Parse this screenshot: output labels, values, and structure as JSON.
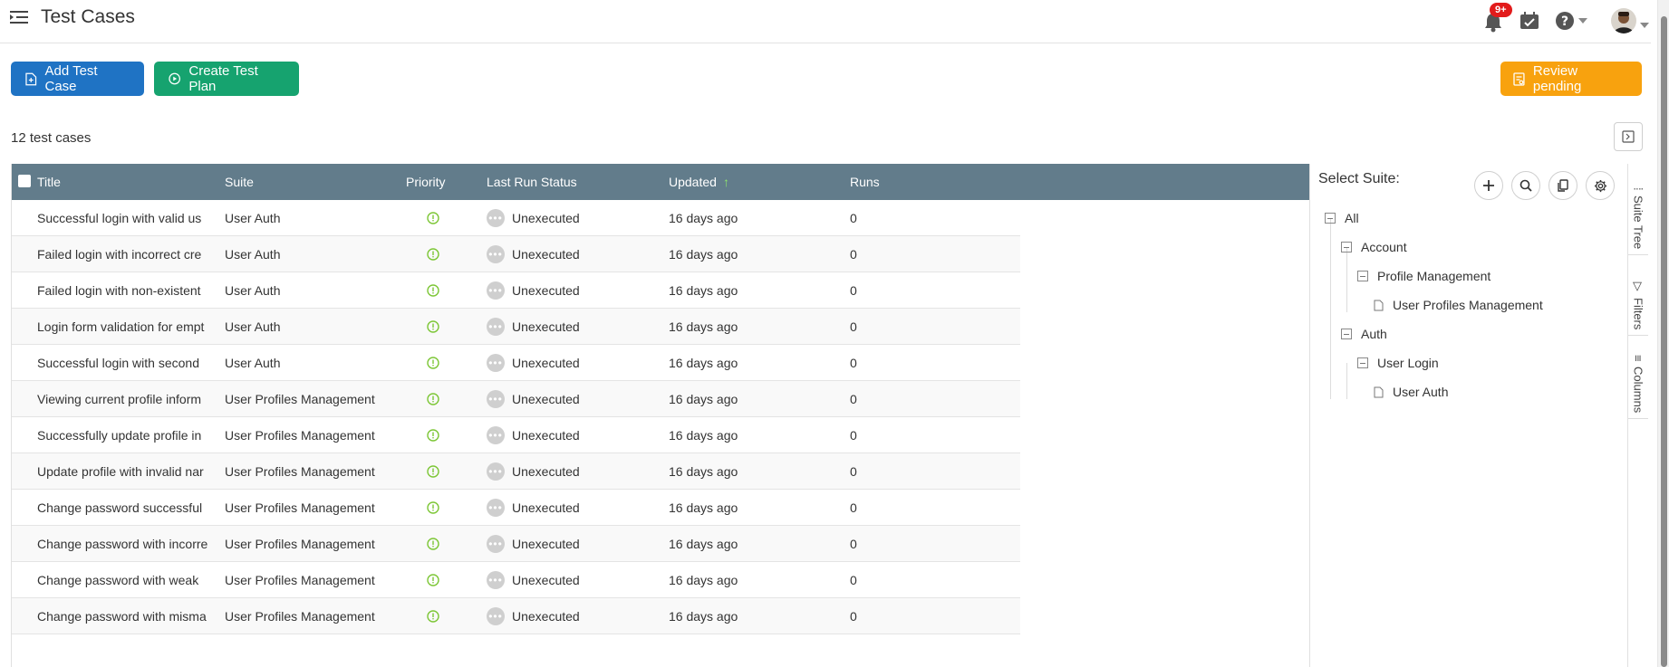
{
  "header": {
    "title": "Test Cases",
    "notification_badge": "9+"
  },
  "toolbar": {
    "add_label": "Add Test Case",
    "plan_label": "Create Test Plan",
    "review_label": "Review pending"
  },
  "summary": {
    "count_text": "12 test cases"
  },
  "table": {
    "columns": [
      "Title",
      "Suite",
      "Priority",
      "Last Run Status",
      "Updated",
      "Runs"
    ],
    "sort_indicator": "↑",
    "rows": [
      {
        "title": "Successful login with valid us",
        "suite": "User Auth",
        "status": "Unexecuted",
        "updated": "16 days ago",
        "runs": "0"
      },
      {
        "title": "Failed login with incorrect cre",
        "suite": "User Auth",
        "status": "Unexecuted",
        "updated": "16 days ago",
        "runs": "0"
      },
      {
        "title": "Failed login with non-existent",
        "suite": "User Auth",
        "status": "Unexecuted",
        "updated": "16 days ago",
        "runs": "0"
      },
      {
        "title": "Login form validation for empt",
        "suite": "User Auth",
        "status": "Unexecuted",
        "updated": "16 days ago",
        "runs": "0"
      },
      {
        "title": "Successful login with second",
        "suite": "User Auth",
        "status": "Unexecuted",
        "updated": "16 days ago",
        "runs": "0"
      },
      {
        "title": "Viewing current profile inform",
        "suite": "User Profiles Management",
        "status": "Unexecuted",
        "updated": "16 days ago",
        "runs": "0"
      },
      {
        "title": "Successfully update profile in",
        "suite": "User Profiles Management",
        "status": "Unexecuted",
        "updated": "16 days ago",
        "runs": "0"
      },
      {
        "title": "Update profile with invalid nar",
        "suite": "User Profiles Management",
        "status": "Unexecuted",
        "updated": "16 days ago",
        "runs": "0"
      },
      {
        "title": "Change password successful",
        "suite": "User Profiles Management",
        "status": "Unexecuted",
        "updated": "16 days ago",
        "runs": "0"
      },
      {
        "title": "Change password with incorre",
        "suite": "User Profiles Management",
        "status": "Unexecuted",
        "updated": "16 days ago",
        "runs": "0"
      },
      {
        "title": "Change password with weak",
        "suite": "User Profiles Management",
        "status": "Unexecuted",
        "updated": "16 days ago",
        "runs": "0"
      },
      {
        "title": "Change password with misma",
        "suite": "User Profiles Management",
        "status": "Unexecuted",
        "updated": "16 days ago",
        "runs": "0"
      }
    ]
  },
  "suite_panel": {
    "label": "Select Suite:",
    "tree": {
      "all": "All",
      "account": "Account",
      "profile_management": "Profile Management",
      "user_profiles_management": "User Profiles Management",
      "auth": "Auth",
      "user_login": "User Login",
      "user_auth": "User Auth"
    }
  },
  "side_tabs": {
    "suite_tree": "Suite Tree",
    "filters": "Filters",
    "columns": "Columns"
  },
  "colors": {
    "add_button": "#1f73c4",
    "plan_button": "#16a36f",
    "review_button": "#f8a20e",
    "table_header": "#627c8b",
    "priority_icon": "#7cc635",
    "badge": "#e21b1b"
  }
}
